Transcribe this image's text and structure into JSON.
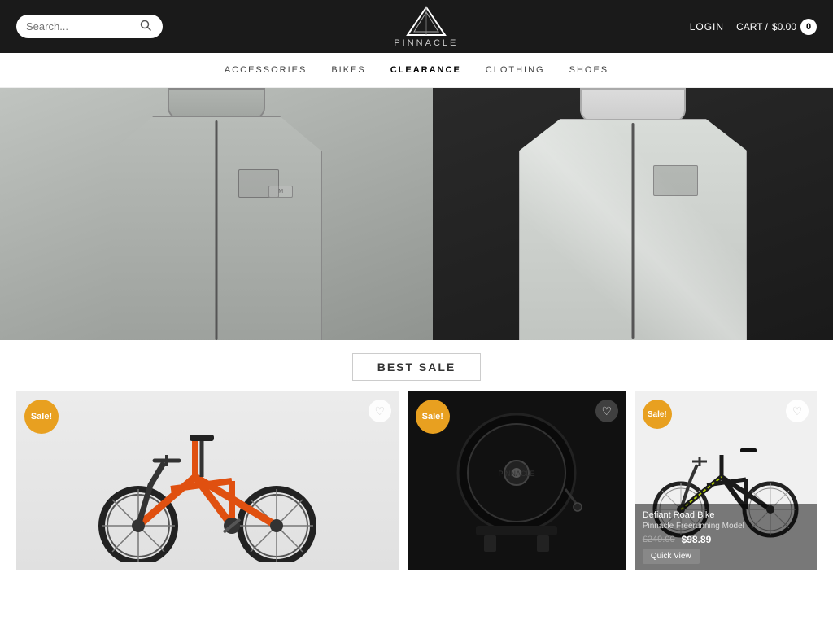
{
  "header": {
    "search_placeholder": "Search...",
    "login_label": "LOGIN",
    "cart_label": "CART /",
    "cart_price": "$0.00",
    "cart_count": "0",
    "logo_text": "PINNACLE"
  },
  "nav": {
    "items": [
      {
        "label": "ACCESSORIES",
        "key": "accessories"
      },
      {
        "label": "BIKES",
        "key": "bikes"
      },
      {
        "label": "CLEARANCE",
        "key": "clearance",
        "active": true
      },
      {
        "label": "CLOTHING",
        "key": "clothing"
      },
      {
        "label": "SHOES",
        "key": "shoes"
      }
    ]
  },
  "best_sale": {
    "title": "BEST SALE"
  },
  "products": [
    {
      "id": "kids-bike",
      "sale_badge": "Sale!",
      "type": "large"
    },
    {
      "id": "trainer",
      "sale_badge": "Sale!",
      "type": "medium"
    },
    {
      "id": "road-bike",
      "sale_badge": "Sale!",
      "title": "Defiant Road Bike",
      "subtitle": "Pinnacle Freerunning Model",
      "old_price": "£249.00",
      "new_price": "$98.89",
      "quick_view": "Quick View",
      "type": "small"
    }
  ]
}
